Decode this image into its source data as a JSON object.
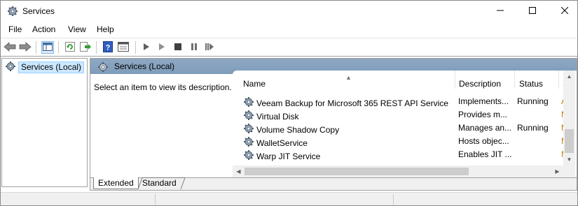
{
  "window": {
    "title": "Services",
    "title_icon": "gear-icon"
  },
  "menu": {
    "items": [
      "File",
      "Action",
      "View",
      "Help"
    ]
  },
  "toolbar": {
    "buttons": [
      "back-arrow-icon",
      "forward-arrow-icon",
      "console-tree-icon",
      "refresh-icon",
      "export-list-icon",
      "help-icon",
      "properties-icon",
      "start-service-icon",
      "start-service-alt-icon",
      "stop-service-icon",
      "pause-service-icon",
      "restart-service-icon"
    ]
  },
  "tree": {
    "root_label": "Services (Local)"
  },
  "panel": {
    "header": "Services (Local)",
    "description_hint": "Select an item to view its description."
  },
  "list": {
    "columns": {
      "name": "Name",
      "description": "Description",
      "status": "Status",
      "startup": "S"
    },
    "rows": [
      {
        "name": "Veeam Backup for Microsoft 365 REST API Service",
        "description": "Implements...",
        "status": "Running",
        "startup": "A"
      },
      {
        "name": "Virtual Disk",
        "description": "Provides m...",
        "status": "",
        "startup": "M"
      },
      {
        "name": "Volume Shadow Copy",
        "description": "Manages an...",
        "status": "Running",
        "startup": "M"
      },
      {
        "name": "WalletService",
        "description": "Hosts objec...",
        "status": "",
        "startup": "M"
      },
      {
        "name": "Warp JIT Service",
        "description": "Enables JIT ...",
        "status": "",
        "startup": "M"
      }
    ]
  },
  "tabs": {
    "extended": "Extended",
    "standard": "Standard"
  },
  "colors": {
    "header_band": "#8ea8c2",
    "selection": "#cce8ff",
    "stop_icon": "#404040"
  }
}
